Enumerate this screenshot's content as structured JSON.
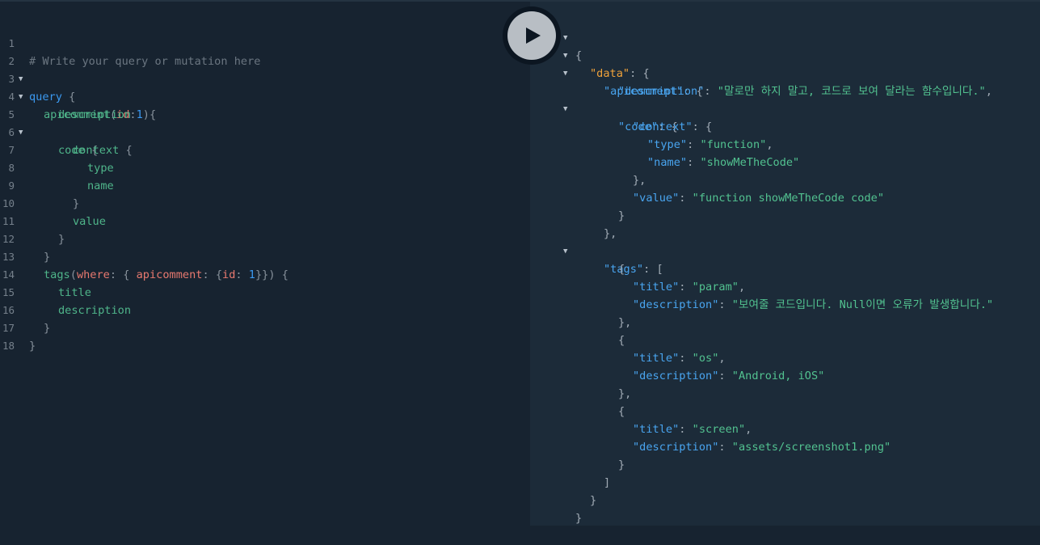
{
  "editor": {
    "line_numbers": [
      "1",
      "2",
      "3",
      "4",
      "5",
      "6",
      "7",
      "8",
      "9",
      "10",
      "11",
      "12",
      "13",
      "14",
      "15",
      "16",
      "17",
      "18"
    ],
    "comment": "# Write your query or mutation here",
    "query_kw": "query",
    "open_brace": "{",
    "close_brace": "}",
    "apicomment": "apicomment",
    "id_arg": "id",
    "id_val": "1",
    "description": "description",
    "code": "code",
    "context": "context",
    "type": "type",
    "name": "name",
    "value": "value",
    "tags": "tags",
    "where": "where",
    "apicomment_arg": "apicomment",
    "title": "title"
  },
  "run_button": {
    "icon": "play-icon"
  },
  "result": {
    "data_key": "\"data\"",
    "apicomment_key": "\"apicomment\"",
    "description_key": "\"description\"",
    "description_val": "\"말로만 하지 말고, 코드로 보여 달라는 함수입니다.\"",
    "code_key": "\"code\"",
    "context_key": "\"context\"",
    "type_key": "\"type\"",
    "type_val": "\"function\"",
    "name_key": "\"name\"",
    "name_val": "\"showMeTheCode\"",
    "value_key": "\"value\"",
    "value_val": "\"function showMeTheCode code\"",
    "tags_key": "\"tags\"",
    "title_key": "\"title\"",
    "tags": [
      {
        "title": "\"param\"",
        "description": "\"보여줄 코드입니다. Null이면 오류가 발생합니다.\""
      },
      {
        "title": "\"os\"",
        "description": "\"Android, iOS\""
      },
      {
        "title": "\"screen\"",
        "description": "\"assets/screenshot1.png\""
      }
    ]
  }
}
